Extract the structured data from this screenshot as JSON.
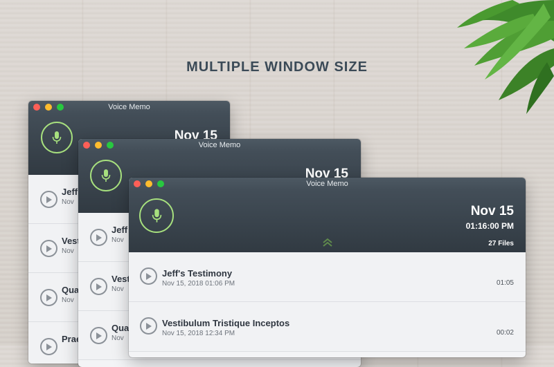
{
  "headline": "MULTIPLE WINDOW SIZE",
  "colors": {
    "accent_green": "#a7e07e",
    "header_dark": "#313a42",
    "title_text": "#3b4a57"
  },
  "windows": [
    {
      "title": "Voice Memo",
      "date": "Nov 15",
      "items": [
        {
          "title": "Jeff",
          "date": "Nov"
        },
        {
          "title": "Vest",
          "date": "Nov"
        },
        {
          "title": "Qua",
          "date": "Nov"
        },
        {
          "title": "Prae",
          "date": ""
        }
      ]
    },
    {
      "title": "Voice Memo",
      "date": "Nov 15",
      "items": [
        {
          "title": "Jeff",
          "date": "Nov"
        },
        {
          "title": "Vest",
          "date": "Nov"
        },
        {
          "title": "Qua",
          "date": "Nov"
        }
      ]
    },
    {
      "title": "Voice Memo",
      "date": "Nov 15",
      "time": "01:16:00 PM",
      "file_count": "27 Files",
      "items": [
        {
          "title": "Jeff's Testimony",
          "date": "Nov 15, 2018  01:06 PM",
          "duration": "01:05"
        },
        {
          "title": "Vestibulum Tristique Inceptos",
          "date": "Nov 15, 2018  12:34 PM",
          "duration": "00:02"
        }
      ]
    }
  ],
  "icons": {
    "record": "microphone-icon",
    "play": "play-icon",
    "expand": "chevron-double-up-icon"
  }
}
